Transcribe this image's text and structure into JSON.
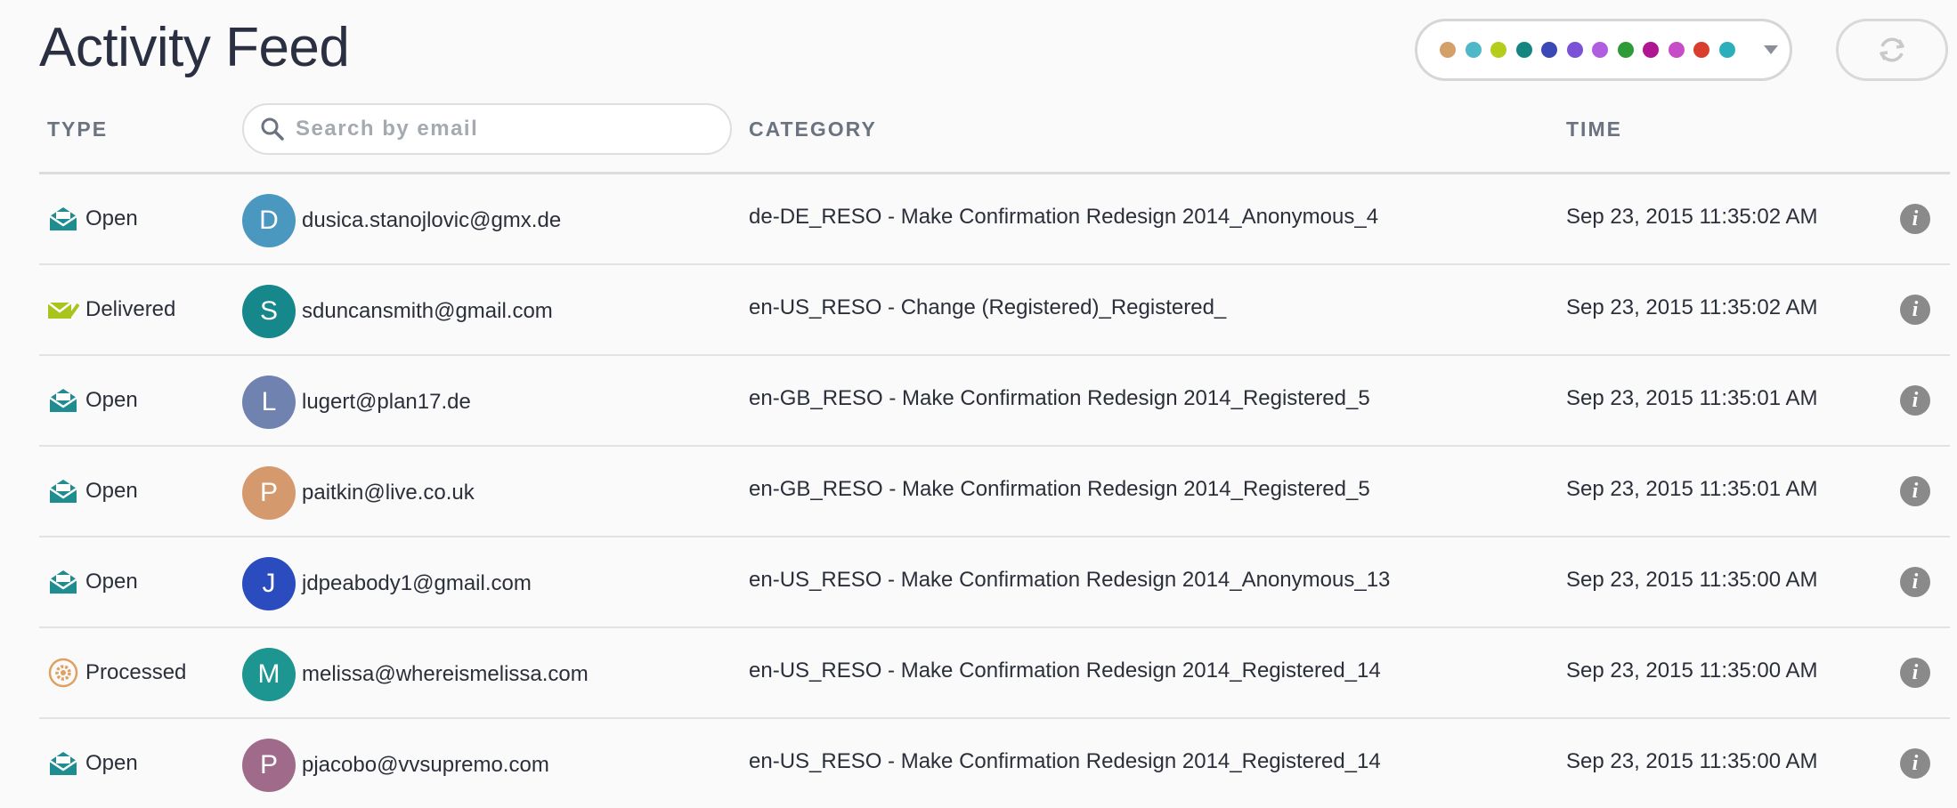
{
  "page": {
    "title": "Activity Feed"
  },
  "filter": {
    "colors": [
      "#d4a06a",
      "#4fb8c8",
      "#b5cc1a",
      "#14867f",
      "#3a49b6",
      "#7b52d6",
      "#b05ee0",
      "#2e9b38",
      "#b01592",
      "#c74cc8",
      "#d93d2e",
      "#2bb0bb"
    ]
  },
  "table": {
    "headers": {
      "type": "TYPE",
      "category": "CATEGORY",
      "time": "TIME"
    },
    "search": {
      "placeholder": "Search by email",
      "value": ""
    },
    "rows": [
      {
        "type": "Open",
        "type_icon": "envelope-open-icon",
        "initial": "D",
        "avatar_color": "#4a97c0",
        "email": "dusica.stanojlovic@gmx.de",
        "category": "de-DE_RESO - Make Confirmation Redesign 2014_Anonymous_4",
        "time": "Sep 23, 2015 11:35:02 AM"
      },
      {
        "type": "Delivered",
        "type_icon": "envelope-check-icon",
        "initial": "S",
        "avatar_color": "#16878a",
        "email": "sduncansmith@gmail.com",
        "category": "en-US_RESO - Change (Registered)_Registered_",
        "time": "Sep 23, 2015 11:35:02 AM"
      },
      {
        "type": "Open",
        "type_icon": "envelope-open-icon",
        "initial": "L",
        "avatar_color": "#6f82b0",
        "email": "lugert@plan17.de",
        "category": "en-GB_RESO - Make Confirmation Redesign 2014_Registered_5",
        "time": "Sep 23, 2015 11:35:01 AM"
      },
      {
        "type": "Open",
        "type_icon": "envelope-open-icon",
        "initial": "P",
        "avatar_color": "#d49a6e",
        "email": "paitkin@live.co.uk",
        "category": "en-GB_RESO - Make Confirmation Redesign 2014_Registered_5",
        "time": "Sep 23, 2015 11:35:01 AM"
      },
      {
        "type": "Open",
        "type_icon": "envelope-open-icon",
        "initial": "J",
        "avatar_color": "#2a4cbf",
        "email": "jdpeabody1@gmail.com",
        "category": "en-US_RESO - Make Confirmation Redesign 2014_Anonymous_13",
        "time": "Sep 23, 2015 11:35:00 AM"
      },
      {
        "type": "Processed",
        "type_icon": "gear-icon",
        "initial": "M",
        "avatar_color": "#1d9590",
        "email": "melissa@whereismelissa.com",
        "category": "en-US_RESO - Make Confirmation Redesign 2014_Registered_14",
        "time": "Sep 23, 2015 11:35:00 AM"
      },
      {
        "type": "Open",
        "type_icon": "envelope-open-icon",
        "initial": "P",
        "avatar_color": "#a06b8a",
        "email": "pjacobo@vvsupremo.com",
        "category": "en-US_RESO - Make Confirmation Redesign 2014_Registered_14",
        "time": "Sep 23, 2015 11:35:00 AM"
      }
    ]
  }
}
